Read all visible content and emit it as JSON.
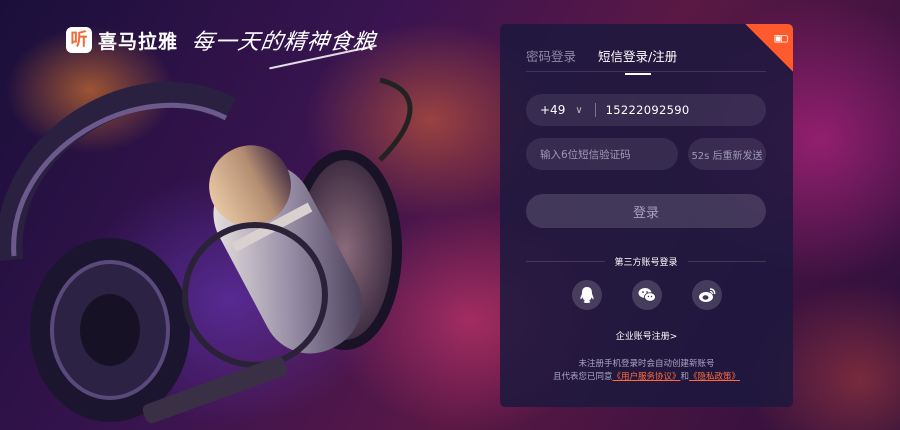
{
  "brand": {
    "logo_glyph": "听",
    "name": "喜马拉雅",
    "slogan": "每一天的精神食粮"
  },
  "login": {
    "tabs": [
      {
        "label": "密码登录",
        "active": false
      },
      {
        "label": "短信登录/注册",
        "active": true
      }
    ],
    "qr_icon": "qr-code-icon",
    "phone": {
      "country_code": "+49",
      "value": "15222092590"
    },
    "sms_code": {
      "placeholder": "输入6位短信验证码"
    },
    "resend_label": "52s 后重新发送",
    "submit_label": "登录",
    "third_party_label": "第三方账号登录",
    "social": [
      {
        "name": "qq",
        "icon": "qq-icon"
      },
      {
        "name": "wechat",
        "icon": "wechat-icon"
      },
      {
        "name": "weibo",
        "icon": "weibo-icon"
      }
    ],
    "enterprise_link": "企业账号注册>",
    "notice": {
      "line1": "未注册手机登录时会自动创建新账号",
      "line2_prefix": "且代表您已同意",
      "agreement": "《用户服务协议》",
      "and": "和",
      "privacy": "《隐私政策》"
    }
  },
  "colors": {
    "accent": "#ff5a2c",
    "panel": "#1c183e"
  }
}
